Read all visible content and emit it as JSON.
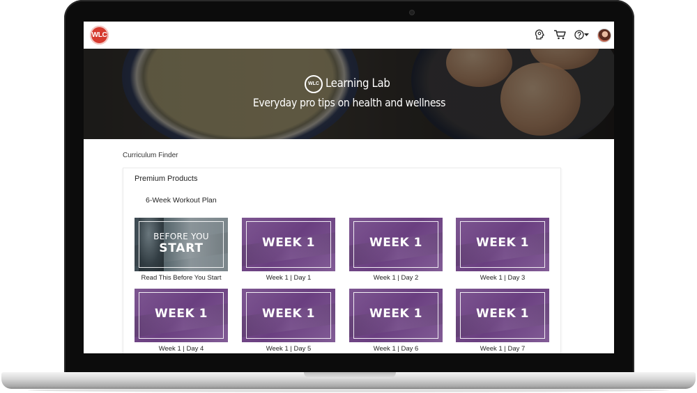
{
  "header": {
    "logo_text": "WLC",
    "icons": [
      "lightbulb-head-icon",
      "cart-icon",
      "help-icon",
      "chevron-down-icon"
    ]
  },
  "hero": {
    "logo_text": "WLC",
    "title": "Learning Lab",
    "subtitle": "Everyday pro tips on health and wellness"
  },
  "breadcrumb": "Curriculum Finder",
  "section": {
    "title": "Premium Products",
    "plan_title": "6-Week Workout Plan",
    "tiles": [
      {
        "overlay_top": "BEFORE YOU",
        "overlay": "START",
        "caption": "Read This Before You Start"
      },
      {
        "overlay": "WEEK 1",
        "caption": "Week 1 | Day 1"
      },
      {
        "overlay": "WEEK 1",
        "caption": "Week 1 | Day 2"
      },
      {
        "overlay": "WEEK 1",
        "caption": "Week 1 | Day 3"
      },
      {
        "overlay": "WEEK 1",
        "caption": "Week 1 | Day 4"
      },
      {
        "overlay": "WEEK 1",
        "caption": "Week 1 | Day 5"
      },
      {
        "overlay": "WEEK 1",
        "caption": "Week 1 | Day 6"
      },
      {
        "overlay": "WEEK 1",
        "caption": "Week 1 | Day 7"
      }
    ]
  },
  "colors": {
    "brand_red": "#d63a2f",
    "tile_purple": "#6a3f80"
  }
}
